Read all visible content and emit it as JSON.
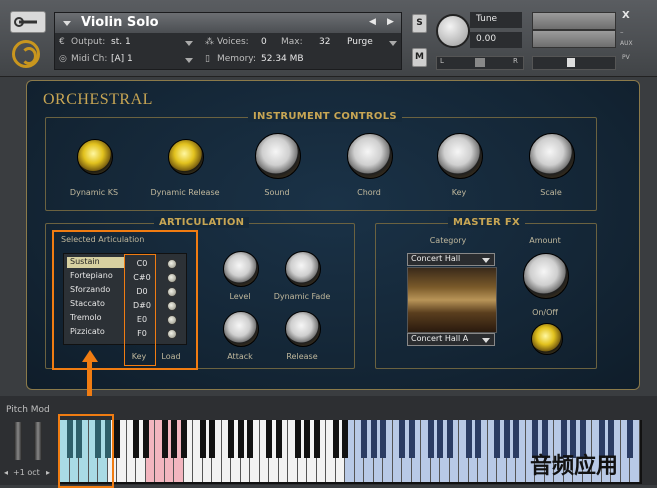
{
  "header": {
    "instrument_name": "Violin Solo",
    "output_label": "Output:",
    "output_value": "st. 1",
    "voices_label": "Voices:",
    "voices_value": "0",
    "max_label": "Max:",
    "max_value": "32",
    "purge_label": "Purge",
    "midi_label": "Midi Ch:",
    "midi_value": "[A] 1",
    "memory_label": "Memory:",
    "memory_value": "52.34 MB",
    "solo_label": "S",
    "mute_label": "M",
    "tune_label": "Tune",
    "tune_value": "0.00",
    "pan_left": "L",
    "pan_right": "R",
    "aux_label": "AUX",
    "pv_label": "PV",
    "close_label": "X"
  },
  "panel": {
    "title": "ORCHESTRAL",
    "instrument_controls": {
      "title": "INSTRUMENT CONTROLS",
      "knobs": [
        "Dynamic KS",
        "Dynamic Release",
        "Sound",
        "Chord",
        "Key",
        "Scale"
      ]
    },
    "articulation": {
      "title": "ARTICULATION",
      "selected_label": "Selected Articulation",
      "items": [
        {
          "name": "Sustain",
          "key": "C0"
        },
        {
          "name": "Fortepiano",
          "key": "C#0"
        },
        {
          "name": "Sforzando",
          "key": "D0"
        },
        {
          "name": "Staccato",
          "key": "D#0"
        },
        {
          "name": "Tremolo",
          "key": "E0"
        },
        {
          "name": "Pizzicato",
          "key": "F0"
        }
      ],
      "key_header": "Key",
      "load_header": "Load",
      "knobs": [
        "Level",
        "Dynamic Fade",
        "Attack",
        "Release"
      ]
    },
    "master_fx": {
      "title": "MASTER FX",
      "category_label": "Category",
      "category_value": "Concert Hall",
      "preset_value": "Concert Hall A",
      "amount_label": "Amount",
      "onoff_label": "On/Off"
    }
  },
  "bottom": {
    "pitch_mod_label": "Pitch Mod",
    "octave_label": "+1 oct"
  },
  "watermark": "音频应用",
  "colors": {
    "accent": "#c8a654",
    "highlight": "#f07c12",
    "panel_bg": "#142636"
  }
}
